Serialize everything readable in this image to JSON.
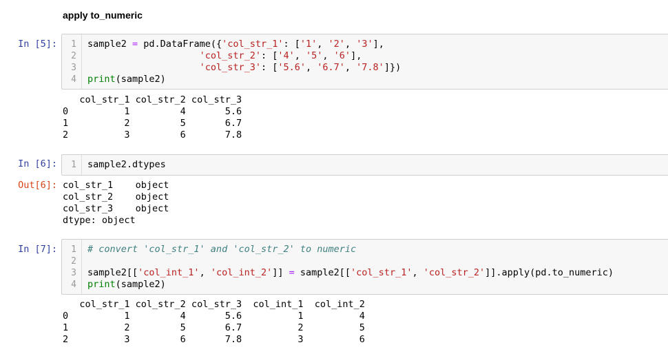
{
  "heading": "apply to_numeric",
  "cell5": {
    "prompt": "In [5]:",
    "line_numbers": [
      "1",
      "2",
      "3",
      "4"
    ],
    "output": "   col_str_1 col_str_2 col_str_3\n0          1         4       5.6\n1          2         5       6.7\n2          3         6       7.8"
  },
  "cell6": {
    "prompt": "In [6]:",
    "line_numbers": [
      "1"
    ],
    "code": "sample2.dtypes",
    "out_prompt": "Out[6]:",
    "output": "col_str_1    object\ncol_str_2    object\ncol_str_3    object\ndtype: object"
  },
  "cell7": {
    "prompt": "In [7]:",
    "line_numbers": [
      "1",
      "2",
      "3",
      "4"
    ],
    "comment": "# convert 'col_str_1' and 'col_str_2' to numeric",
    "output": "   col_str_1 col_str_2 col_str_3  col_int_1  col_int_2\n0          1         4       5.6          1          4\n1          2         5       6.7          2          5\n2          3         6       7.8          3          6"
  }
}
